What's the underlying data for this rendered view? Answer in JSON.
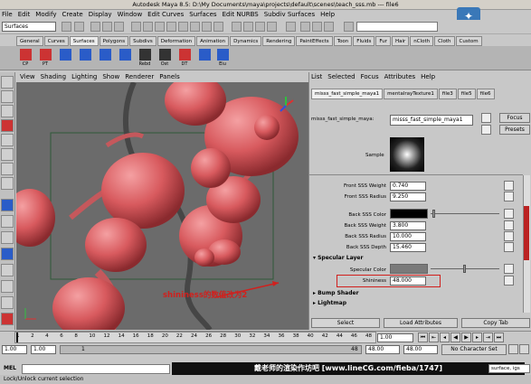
{
  "titlebar": {
    "title": "Autodesk Maya 8.5: D:\\My Documents\\maya\\projects\\default\\scenes\\teach_sss.mb  ---  file6"
  },
  "menubar": {
    "items": [
      "File",
      "Edit",
      "Modify",
      "Create",
      "Display",
      "Window",
      "Edit Curves",
      "Surfaces",
      "Edit NURBS",
      "Subdiv Surfaces",
      "Help"
    ]
  },
  "statusline": {
    "mode": "Surfaces"
  },
  "shelf": {
    "tabs": [
      "General",
      "Curves",
      "Surfaces",
      "Polygons",
      "Subdivs",
      "Deformation",
      "Animation",
      "Dynamics",
      "Rendering",
      "PaintEffects",
      "Toon",
      "Fluids",
      "Fur",
      "Hair",
      "nCloth",
      "Cloth",
      "Custom"
    ],
    "active_tab": "Surfaces",
    "icons": [
      "CP",
      "PT",
      "",
      "",
      "",
      "",
      "Rebd",
      "Ost",
      "DT",
      "",
      "Eiu"
    ]
  },
  "viewport": {
    "menu": [
      "View",
      "Shading",
      "Lighting",
      "Show",
      "Renderer",
      "Panels"
    ],
    "accent_color": "#e06a6d"
  },
  "attribute_editor": {
    "menu": [
      "List",
      "Selected",
      "Focus",
      "Attributes",
      "Help"
    ],
    "tabs": [
      "misss_fast_simple_maya1",
      "mentalrayTexture1",
      "file3",
      "file5",
      "file6"
    ],
    "node_label": "misss_fast_simple_maya:",
    "node_name": "misss_fast_simple_maya1",
    "focus_label": "Focus",
    "presets_label": "Presets",
    "sample_label": "Sample",
    "front_sss_weight_label": "Front SSS Weight",
    "front_sss_weight": "0.740",
    "front_sss_radius_label": "Front SSS Radius",
    "front_sss_radius": "9.250",
    "back_sss_color_label": "Back SSS Color",
    "back_sss_weight_label": "Back SSS Weight",
    "back_sss_weight": "3.800",
    "back_sss_radius_label": "Back SSS Radius",
    "back_sss_radius": "10.000",
    "back_sss_depth_label": "Back SSS Depth",
    "back_sss_depth": "15.460",
    "specular_layer": "Specular Layer",
    "specular_color_label": "Specular Color",
    "shininess_label": "Shininess",
    "shininess": "48.000",
    "bump_shader": "Bump Shader",
    "lightmap": "Lightmap",
    "select_label": "Select",
    "load_attributes_label": "Load Attributes",
    "copy_tab_label": "Copy Tab"
  },
  "timeline": {
    "ticks": [
      "1",
      "2",
      "4",
      "6",
      "8",
      "10",
      "12",
      "14",
      "16",
      "18",
      "20",
      "22",
      "24",
      "26",
      "28",
      "30",
      "32",
      "34",
      "36",
      "38",
      "40",
      "42",
      "44",
      "46",
      "48"
    ],
    "current_frame": "1.00"
  },
  "rangebar": {
    "start": "1.00",
    "inner_start": "1.00",
    "current": "1",
    "end_label": "48",
    "end": "48.00",
    "end2": "48.00",
    "character_set": "No Character Set"
  },
  "cmdbar": {
    "label": "MEL"
  },
  "watermark": "戴老师的渲染作坊吧 [www.lineCG.com/fieba/1747]",
  "watermark_right": "surface, igs",
  "annotation": "shininess的数值改为2",
  "helpline": "Lock/Unlock current selection"
}
